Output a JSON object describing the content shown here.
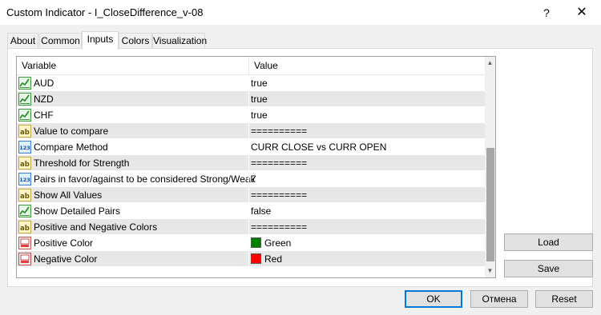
{
  "window": {
    "title": "Custom Indicator - I_CloseDifference_v-08",
    "help_glyph": "?",
    "close_glyph": "✕"
  },
  "tabs": [
    {
      "label": "About",
      "active": false
    },
    {
      "label": "Common",
      "active": false
    },
    {
      "label": "Inputs",
      "active": true
    },
    {
      "label": "Colors",
      "active": false
    },
    {
      "label": "Visualization",
      "active": false
    }
  ],
  "grid": {
    "headers": {
      "variable": "Variable",
      "value": "Value"
    },
    "rows": [
      {
        "icon": "bool-chart-icon",
        "name": "AUD",
        "value": "true"
      },
      {
        "icon": "bool-chart-icon",
        "name": "NZD",
        "value": "true"
      },
      {
        "icon": "bool-chart-icon",
        "name": "CHF",
        "value": "true"
      },
      {
        "icon": "string-ab-icon",
        "name": "Value to compare",
        "value": "=========="
      },
      {
        "icon": "enum-123-icon",
        "name": "Compare Method",
        "value": "CURR CLOSE vs CURR OPEN"
      },
      {
        "icon": "string-ab-icon",
        "name": "Threshold for Strength",
        "value": "=========="
      },
      {
        "icon": "enum-123-icon",
        "name": "Pairs in favor/against to be considered Strong/Weak",
        "value": "7"
      },
      {
        "icon": "string-ab-icon",
        "name": "Show All Values",
        "value": "=========="
      },
      {
        "icon": "bool-chart-icon",
        "name": "Show Detailed Pairs",
        "value": "false"
      },
      {
        "icon": "string-ab-icon",
        "name": "Positive and Negative Colors",
        "value": "=========="
      },
      {
        "icon": "color-palette-icon",
        "name": "Positive Color",
        "value": "Green",
        "swatch": "#008000"
      },
      {
        "icon": "color-palette-icon",
        "name": "Negative Color",
        "value": "Red",
        "swatch": "#ff0000"
      }
    ]
  },
  "side_buttons": {
    "load": "Load",
    "save": "Save"
  },
  "footer_buttons": {
    "ok": "OK",
    "cancel": "Отмена",
    "reset": "Reset"
  }
}
